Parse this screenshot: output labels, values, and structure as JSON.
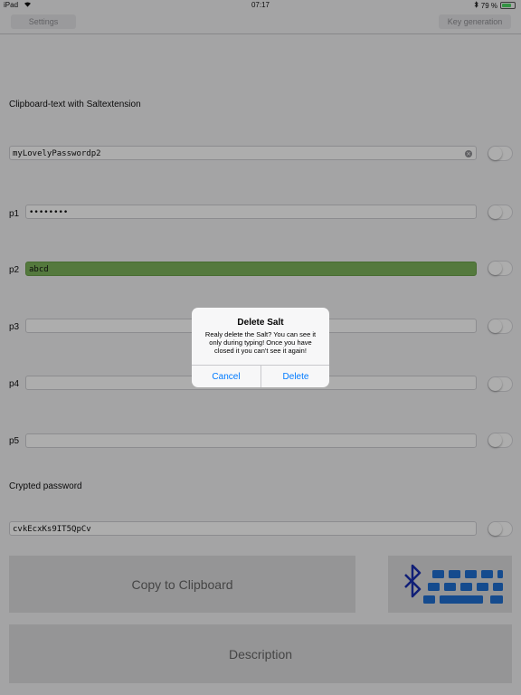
{
  "status": {
    "device": "iPad",
    "time": "07:17",
    "battery": "79 %"
  },
  "nav": {
    "left": "Settings",
    "right": "Key generation"
  },
  "clipboard_label": "Clipboard-text with Saltextension",
  "clipboard_value": "myLovelyPasswordp2",
  "fields": [
    {
      "label": "p1",
      "value": "••••••••"
    },
    {
      "label": "p2",
      "value": "abcd"
    },
    {
      "label": "p3",
      "value": ""
    },
    {
      "label": "p4",
      "value": ""
    },
    {
      "label": "p5",
      "value": ""
    }
  ],
  "crypted_label": "Crypted password",
  "crypted_value": "cvkEcxKs9IT5QpCv",
  "copy_button": "Copy to Clipboard",
  "description_button": "Description",
  "alert": {
    "title": "Delete Salt",
    "message": "Realy delete the Salt? You can see it only during typing! Once you have closed it you can't see it again!",
    "cancel": "Cancel",
    "delete": "Delete"
  },
  "colors": {
    "accent": "#007aff",
    "filled_field": "#7cb35a",
    "keyboard_icon": "#1f6fd1",
    "bluetooth_icon": "#1a2fb0"
  }
}
